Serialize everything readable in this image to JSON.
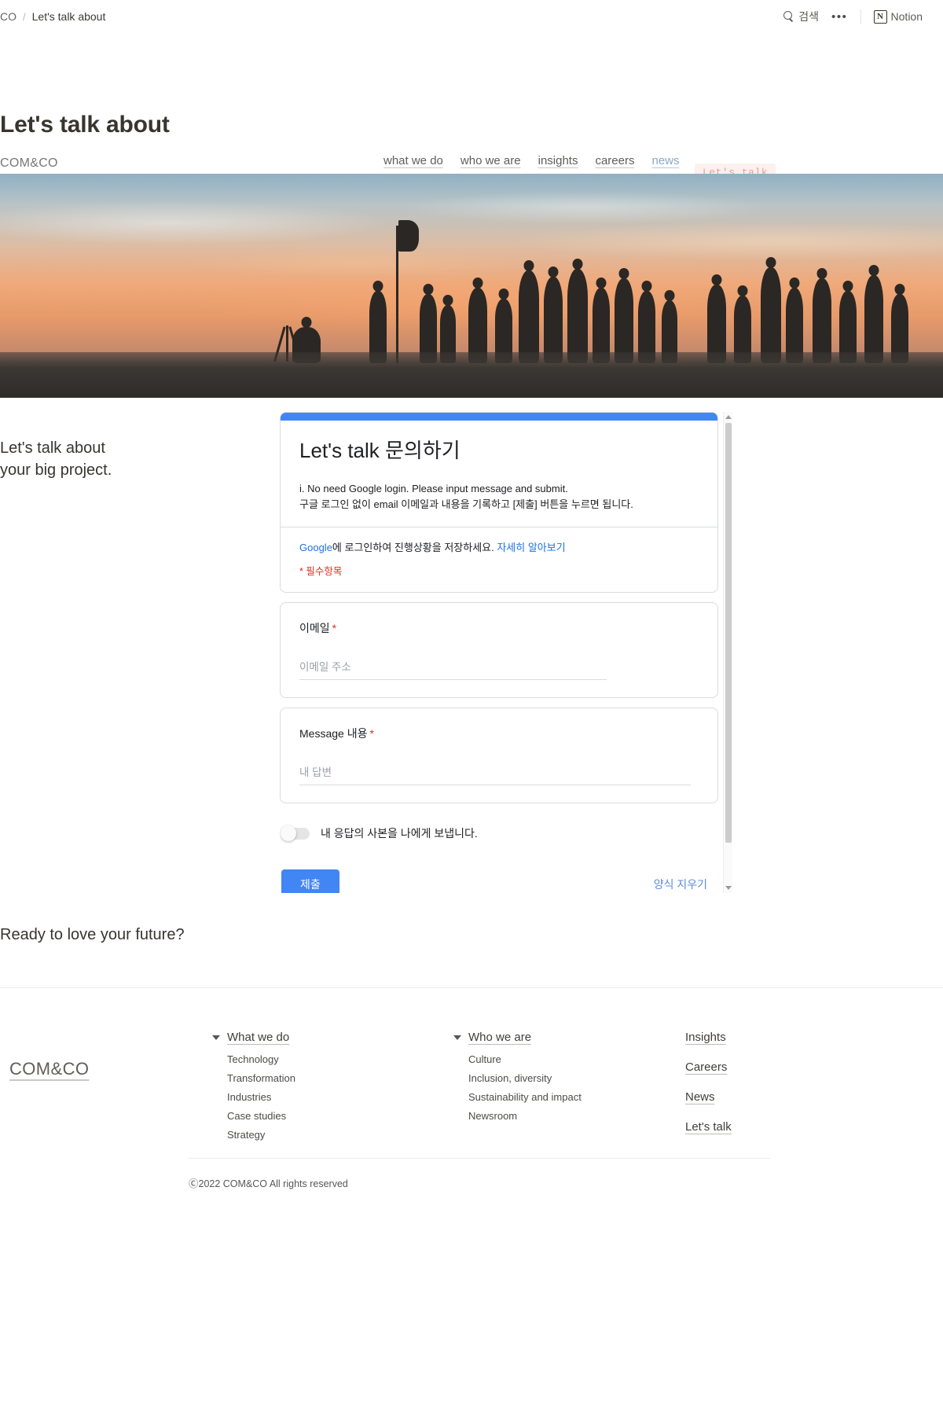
{
  "topbar": {
    "breadcrumb": {
      "parent": "CO",
      "separator": "/",
      "current": "Let's talk about"
    },
    "search_label": "검색",
    "more_label": "•••",
    "notion_logo_glyph": "N",
    "notion_label": "Notion"
  },
  "page": {
    "title": "Let's talk about"
  },
  "site_nav": {
    "logo": "COM&CO",
    "links": [
      {
        "label": "what we do",
        "active": false
      },
      {
        "label": "who we are",
        "active": false
      },
      {
        "label": "insights",
        "active": false
      },
      {
        "label": "careers",
        "active": false
      },
      {
        "label": "news",
        "active": true
      }
    ],
    "cta": "Let's talk"
  },
  "hero": {
    "alt": "silhouette of a group of people on a hilltop at sunset with a flag"
  },
  "section": {
    "headline": "Let's talk about\nyour big project."
  },
  "gform": {
    "accent_color": "#4285f4",
    "title": "Let's talk 문의하기",
    "description": "i. No need Google login. Please input message and submit.\n   구글 로그인 없이 email 이메일과 내용을 기록하고 [제출] 버튼을 누르면 됩니다.",
    "signin_prefix": "Google",
    "signin_mid": "에 로그인하여 진행상황을 저장하세요. ",
    "signin_link": "자세히 알아보기",
    "required_note": "* 필수항목",
    "fields": [
      {
        "label": "이메일",
        "required_mark": "*",
        "placeholder": "이메일 주소",
        "value": ""
      },
      {
        "label": "Message 내용",
        "required_mark": "*",
        "placeholder": "내 답변",
        "value": ""
      }
    ],
    "toggle_label": "내 응답의 사본을 나에게 보냅니다.",
    "toggle_on": false,
    "submit_label": "제출",
    "clear_label": "양식 지우기"
  },
  "ready": {
    "title": "Ready to love your future?"
  },
  "footer": {
    "logo": "COM&CO",
    "columns": [
      {
        "head": "What we do",
        "items": [
          "Technology",
          "Transformation",
          "Industries",
          "Case studies",
          "Strategy"
        ]
      },
      {
        "head": "Who we are",
        "items": [
          "Culture",
          "Inclusion, diversity",
          "Sustainability and impact",
          "Newsroom"
        ]
      }
    ],
    "links": [
      "Insights",
      "Careers",
      "News",
      "Let's talk"
    ],
    "copyright": "Ⓒ2022 COM&CO All rights reserved"
  }
}
